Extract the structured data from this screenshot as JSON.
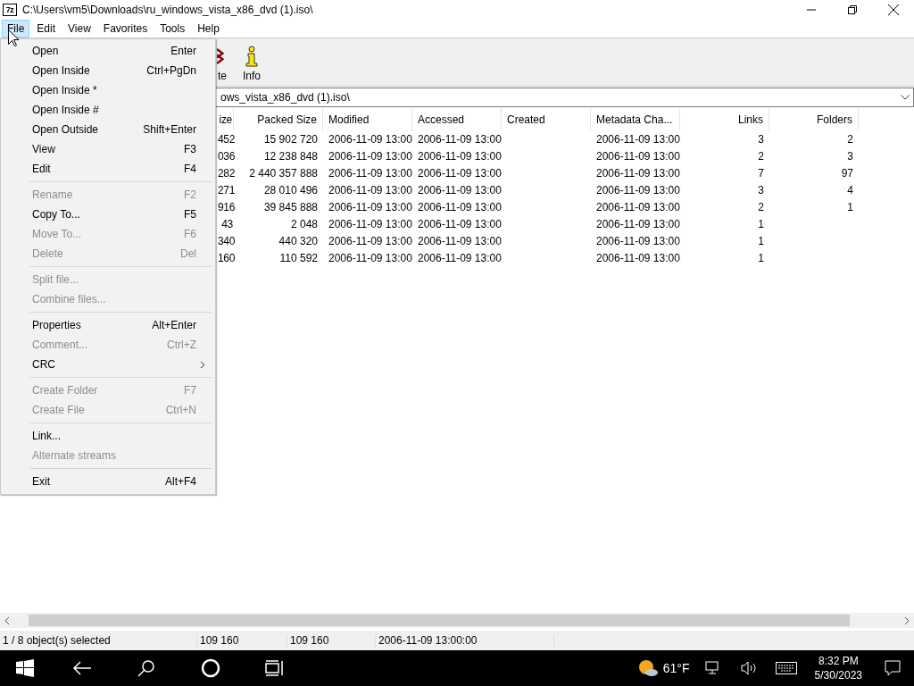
{
  "window": {
    "app_icon": "7z",
    "title": "C:\\Users\\vm5\\Downloads\\ru_windows_vista_x86_dvd (1).iso\\"
  },
  "menu_bar": [
    {
      "label": "File",
      "selected": true
    },
    {
      "label": "Edit",
      "selected": false
    },
    {
      "label": "View",
      "selected": false
    },
    {
      "label": "Favorites",
      "selected": false
    },
    {
      "label": "Tools",
      "selected": false
    },
    {
      "label": "Help",
      "selected": false
    }
  ],
  "toolbar": [
    {
      "kind": "delete",
      "label": "te"
    },
    {
      "kind": "info",
      "label": "Info"
    }
  ],
  "address": {
    "value": "ows_vista_x86_dvd (1).iso\\"
  },
  "table": {
    "columns": [
      {
        "label": "ize"
      },
      {
        "label": "Packed Size"
      },
      {
        "label": "Modified"
      },
      {
        "label": "Accessed"
      },
      {
        "label": "Created"
      },
      {
        "label": "Metadata Cha..."
      },
      {
        "label": "Links"
      },
      {
        "label": "Folders"
      }
    ],
    "rows": [
      {
        "size": "452",
        "packed_size": "15 902 720",
        "modified": "2006-11-09 13:00",
        "accessed": "2006-11-09 13:00",
        "metadata_changed": "2006-11-09 13:00",
        "links": "3",
        "folders": "2"
      },
      {
        "size": "036",
        "packed_size": "12 238 848",
        "modified": "2006-11-09 13:00",
        "accessed": "2006-11-09 13:00",
        "metadata_changed": "2006-11-09 13:00",
        "links": "2",
        "folders": "3"
      },
      {
        "size": "282",
        "packed_size": "2 440 357 888",
        "modified": "2006-11-09 13:00",
        "accessed": "2006-11-09 13:00",
        "metadata_changed": "2006-11-09 13:00",
        "links": "7",
        "folders": "97"
      },
      {
        "size": "271",
        "packed_size": "28 010 496",
        "modified": "2006-11-09 13:00",
        "accessed": "2006-11-09 13:00",
        "metadata_changed": "2006-11-09 13:00",
        "links": "3",
        "folders": "4"
      },
      {
        "size": "916",
        "packed_size": "39 845 888",
        "modified": "2006-11-09 13:00",
        "accessed": "2006-11-09 13:00",
        "metadata_changed": "2006-11-09 13:00",
        "links": "2",
        "folders": "1"
      },
      {
        "size": "43",
        "packed_size": "2 048",
        "modified": "2006-11-09 13:00",
        "accessed": "2006-11-09 13:00",
        "metadata_changed": "2006-11-09 13:00",
        "links": "1"
      },
      {
        "size": "340",
        "packed_size": "440 320",
        "modified": "2006-11-09 13:00",
        "accessed": "2006-11-09 13:00",
        "metadata_changed": "2006-11-09 13:00",
        "links": "1"
      },
      {
        "size": "160",
        "packed_size": "110 592",
        "modified": "2006-11-09 13:00",
        "accessed": "2006-11-09 13:00",
        "metadata_changed": "2006-11-09 13:00",
        "links": "1"
      }
    ]
  },
  "status_bar": [
    "1 / 8 object(s) selected",
    "109 160",
    "109 160",
    "2006-11-09 13:00:00"
  ],
  "file_menu": [
    {
      "kind": "item",
      "label": "Open",
      "shortcut": "Enter",
      "disabled": false
    },
    {
      "kind": "item",
      "label": "Open Inside",
      "shortcut": "Ctrl+PgDn",
      "disabled": false
    },
    {
      "kind": "item",
      "label": "Open Inside *",
      "disabled": false
    },
    {
      "kind": "item",
      "label": "Open Inside #",
      "disabled": false
    },
    {
      "kind": "item",
      "label": "Open Outside",
      "shortcut": "Shift+Enter",
      "disabled": false
    },
    {
      "kind": "item",
      "label": "View",
      "shortcut": "F3",
      "disabled": false
    },
    {
      "kind": "item",
      "label": "Edit",
      "shortcut": "F4",
      "disabled": false
    },
    {
      "kind": "separator"
    },
    {
      "kind": "item",
      "label": "Rename",
      "shortcut": "F2",
      "disabled": true
    },
    {
      "kind": "item",
      "label": "Copy To...",
      "shortcut": "F5",
      "disabled": false
    },
    {
      "kind": "item",
      "label": "Move To...",
      "shortcut": "F6",
      "disabled": true
    },
    {
      "kind": "item",
      "label": "Delete",
      "shortcut": "Del",
      "disabled": true
    },
    {
      "kind": "separator"
    },
    {
      "kind": "item",
      "label": "Split file...",
      "disabled": true
    },
    {
      "kind": "item",
      "label": "Combine files...",
      "disabled": true
    },
    {
      "kind": "separator"
    },
    {
      "kind": "item",
      "label": "Properties",
      "shortcut": "Alt+Enter",
      "disabled": false
    },
    {
      "kind": "item",
      "label": "Comment...",
      "shortcut": "Ctrl+Z",
      "disabled": true
    },
    {
      "kind": "submenu",
      "label": "CRC",
      "disabled": false
    },
    {
      "kind": "separator"
    },
    {
      "kind": "item",
      "label": "Create Folder",
      "shortcut": "F7",
      "disabled": true
    },
    {
      "kind": "item",
      "label": "Create File",
      "shortcut": "Ctrl+N",
      "disabled": true
    },
    {
      "kind": "separator"
    },
    {
      "kind": "item",
      "label": "Link...",
      "disabled": false
    },
    {
      "kind": "item",
      "label": "Alternate streams",
      "disabled": true
    },
    {
      "kind": "separator"
    },
    {
      "kind": "item",
      "label": "Exit",
      "shortcut": "Alt+F4",
      "disabled": false
    }
  ],
  "taskbar": {
    "temperature": "61°F",
    "time": "8:32 PM",
    "date": "5/30/2023"
  }
}
